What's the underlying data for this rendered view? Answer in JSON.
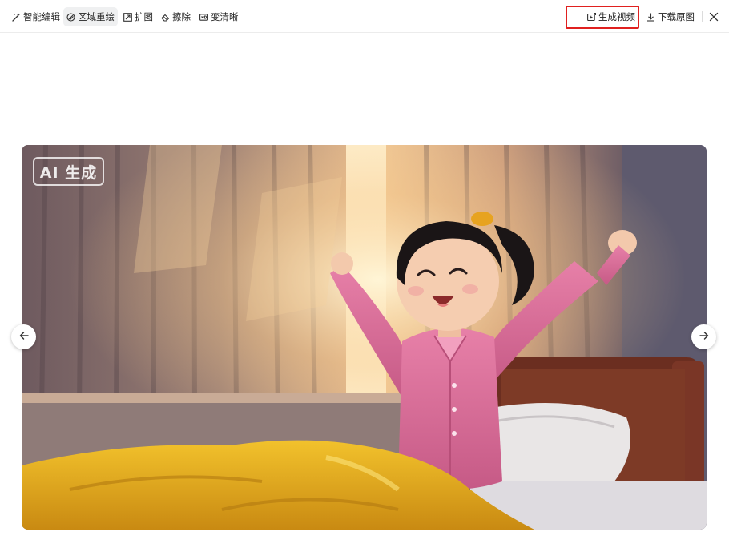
{
  "toolbar": {
    "tools": [
      {
        "label": "智能编辑",
        "icon": "magic-wand-icon",
        "active": false
      },
      {
        "label": "区域重绘",
        "icon": "brush-icon",
        "active": true
      },
      {
        "label": "扩图",
        "icon": "expand-icon",
        "active": false
      },
      {
        "label": "擦除",
        "icon": "eraser-icon",
        "active": false
      },
      {
        "label": "变清晰",
        "icon": "hd-icon",
        "active": false
      }
    ],
    "generate_video_label": "生成视频",
    "download_label": "下载原图",
    "highlight_color": "#e0201f"
  },
  "image": {
    "badge_text": "AI 生成",
    "subject": "anime girl in pink pajamas stretching in bed at sunrise"
  },
  "navigation": {
    "prev_icon": "arrow-left-icon",
    "next_icon": "arrow-right-icon",
    "close_icon": "close-icon"
  }
}
